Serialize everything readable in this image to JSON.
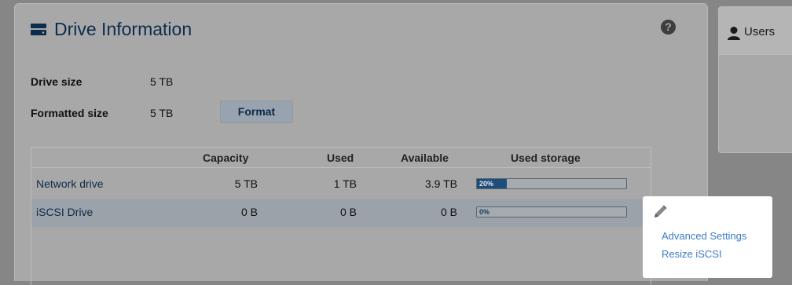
{
  "drive_panel": {
    "title": "Drive Information",
    "help_symbol": "?",
    "drive_size_label": "Drive size",
    "drive_size_value": "5 TB",
    "formatted_size_label": "Formatted size",
    "formatted_size_value": "5 TB",
    "format_button_label": "Format",
    "table": {
      "columns": [
        "",
        "Capacity",
        "Used",
        "Available",
        "Used storage"
      ],
      "rows": [
        {
          "name": "Network drive",
          "capacity": "5 TB",
          "used": "1 TB",
          "available": "3.9 TB",
          "used_storage_label": "20%",
          "used_storage_fraction": 0.2
        },
        {
          "name": "iSCSI Drive",
          "capacity": "0 B",
          "used": "0 B",
          "available": "0 B",
          "used_storage_label": "0%",
          "used_storage_fraction": 0.0
        }
      ]
    }
  },
  "context_menu": {
    "items": [
      "Advanced Settings",
      "Resize iSCSI"
    ]
  },
  "users_panel": {
    "title": "Users"
  },
  "icons": [
    "drive-icon",
    "help-icon",
    "pencil-icon",
    "user-icon"
  ],
  "colors": {
    "title_blue": "#0d2c4e",
    "link_blue": "#3d7bc4",
    "bar_fill": "#1d4d78"
  }
}
